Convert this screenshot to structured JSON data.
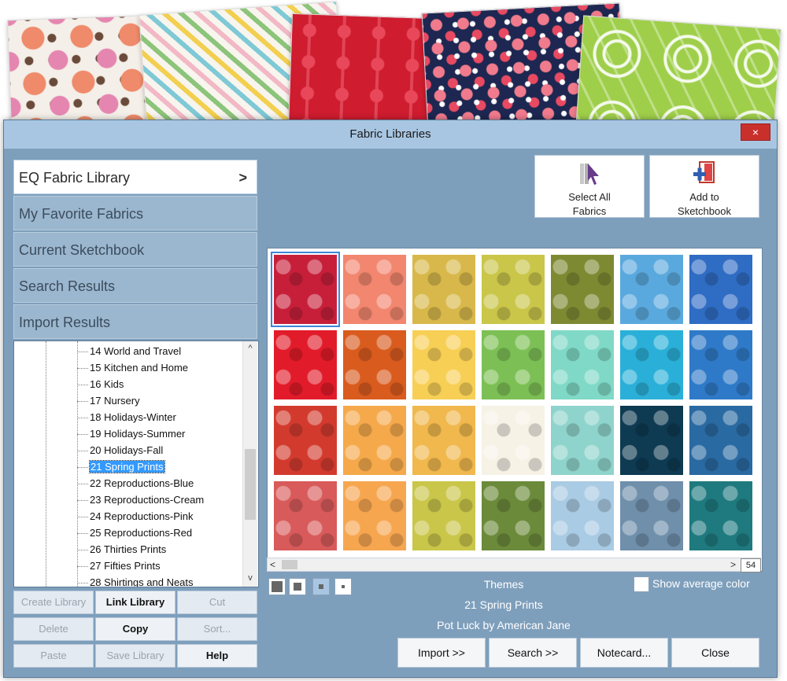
{
  "window": {
    "title": "Fabric Libraries",
    "close_label": "×"
  },
  "libraries": [
    {
      "label": "EQ Fabric Library",
      "active": true
    },
    {
      "label": "My Favorite Fabrics",
      "active": false
    },
    {
      "label": "Current Sketchbook",
      "active": false
    },
    {
      "label": "Search Results",
      "active": false
    },
    {
      "label": "Import Results",
      "active": false
    }
  ],
  "chevron": ">",
  "tree": {
    "items": [
      "14 World and Travel",
      "15 Kitchen and Home",
      "16 Kids",
      "17 Nursery",
      "18 Holidays-Winter",
      "19 Holidays-Summer",
      "20 Holidays-Fall",
      "21 Spring Prints",
      "22 Reproductions-Blue",
      "23 Reproductions-Cream",
      "24 Reproductions-Pink",
      "25 Reproductions-Red",
      "26 Thirties Prints",
      "27 Fifties Prints",
      "28 Shirtings and Neats"
    ],
    "selected": "21 Spring Prints",
    "scroll_up": "^",
    "scroll_down": "v"
  },
  "library_buttons": {
    "create": "Create Library",
    "link": "Link Library",
    "cut": "Cut",
    "delete": "Delete",
    "copy": "Copy",
    "sort": "Sort...",
    "paste": "Paste",
    "save": "Save Library",
    "help": "Help"
  },
  "top_buttons": {
    "select_all_line1": "Select All",
    "select_all_line2": "Fabrics",
    "add_line1": "Add to",
    "add_line2": "Sketchbook"
  },
  "swatch_colors": [
    "#c71f3a",
    "#f2866e",
    "#d8b84a",
    "#c9c64a",
    "#7e8a32",
    "#5aa9de",
    "#2f6cc4",
    "#e21b2a",
    "#d95b1e",
    "#f7cf55",
    "#7cc055",
    "#7fd9c6",
    "#2ab0d8",
    "#2f7ac8",
    "#d33a2e",
    "#f5a94a",
    "#f0b84d",
    "#f6f2e6",
    "#8fd4cc",
    "#0e3a52",
    "#2a6aa2",
    "#d85a5a",
    "#f7a650",
    "#c9c64a",
    "#6b8a3a",
    "#a9cbe3",
    "#6f8fab",
    "#1f7a7f"
  ],
  "grid_scroll": {
    "left": "<",
    "right": ">",
    "count": "54"
  },
  "info": {
    "category": "Themes",
    "library": "21 Spring Prints",
    "collection": "Pot Luck by American Jane"
  },
  "show_average_label": "Show average color",
  "bottom_buttons": {
    "import": "Import   >>",
    "search": "Search   >>",
    "notecard": "Notecard...",
    "close": "Close"
  }
}
